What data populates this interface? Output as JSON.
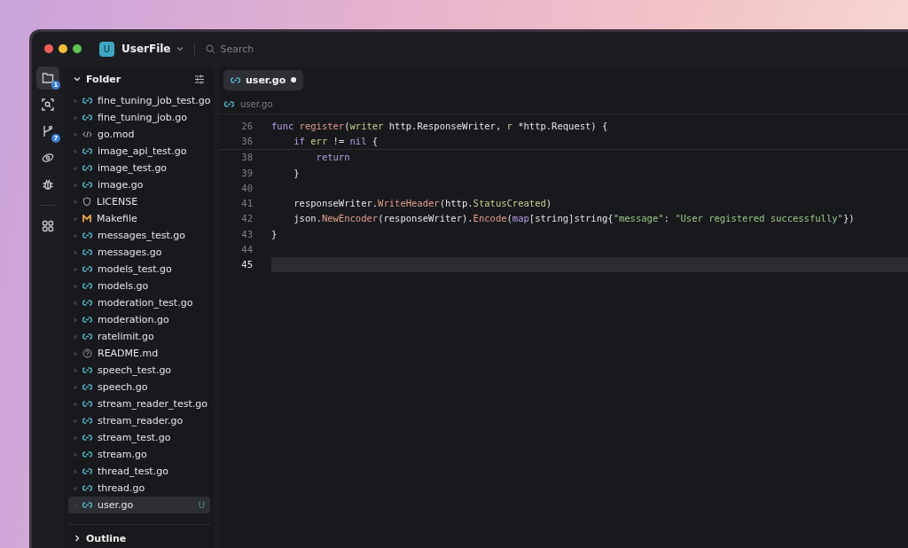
{
  "window": {
    "workspace_initial": "U",
    "workspace": "UserFile",
    "search_placeholder": "Search"
  },
  "activity_bar": [
    {
      "kind": "files",
      "badge": "1",
      "selected": true
    },
    {
      "kind": "scan",
      "selected": false
    },
    {
      "kind": "git",
      "badge": "7",
      "selected": false
    },
    {
      "kind": "eye",
      "selected": false
    },
    {
      "kind": "bug",
      "selected": false
    },
    {
      "kind": "separator"
    },
    {
      "kind": "grid",
      "selected": false
    }
  ],
  "sidebar": {
    "title": "Folder",
    "expanded": true,
    "outline": {
      "title": "Outline",
      "expanded": false
    },
    "items": [
      {
        "name": "fine_tuning_job_test.go",
        "kind": "go",
        "selected": false
      },
      {
        "name": "fine_tuning_job.go",
        "kind": "go",
        "selected": false
      },
      {
        "name": "go.mod",
        "kind": "mod",
        "selected": false
      },
      {
        "name": "image_api_test.go",
        "kind": "go",
        "selected": false
      },
      {
        "name": "image_test.go",
        "kind": "go",
        "selected": false
      },
      {
        "name": "image.go",
        "kind": "go",
        "selected": false
      },
      {
        "name": "LICENSE",
        "kind": "license",
        "selected": false
      },
      {
        "name": "Makefile",
        "kind": "make",
        "selected": false
      },
      {
        "name": "messages_test.go",
        "kind": "go",
        "selected": false
      },
      {
        "name": "messages.go",
        "kind": "go",
        "selected": false
      },
      {
        "name": "models_test.go",
        "kind": "go",
        "selected": false
      },
      {
        "name": "models.go",
        "kind": "go",
        "selected": false
      },
      {
        "name": "moderation_test.go",
        "kind": "go",
        "selected": false
      },
      {
        "name": "moderation.go",
        "kind": "go",
        "selected": false
      },
      {
        "name": "ratelimit.go",
        "kind": "go",
        "selected": false
      },
      {
        "name": "README.md",
        "kind": "readme",
        "selected": false
      },
      {
        "name": "speech_test.go",
        "kind": "go",
        "selected": false
      },
      {
        "name": "speech.go",
        "kind": "go",
        "selected": false
      },
      {
        "name": "stream_reader_test.go",
        "kind": "go",
        "selected": false
      },
      {
        "name": "stream_reader.go",
        "kind": "go",
        "selected": false
      },
      {
        "name": "stream_test.go",
        "kind": "go",
        "selected": false
      },
      {
        "name": "stream.go",
        "kind": "go",
        "selected": false
      },
      {
        "name": "thread_test.go",
        "kind": "go",
        "selected": false
      },
      {
        "name": "thread.go",
        "kind": "go",
        "selected": false
      },
      {
        "name": "user.go",
        "kind": "go",
        "selected": true,
        "status": "U"
      }
    ]
  },
  "tabs": [
    {
      "label": "user.go",
      "selected": true,
      "modified": true
    }
  ],
  "breadcrumb": "user.go",
  "sticky_lines": [
    {
      "number": "26",
      "current": false,
      "tokens": [
        {
          "text": "func ",
          "kind": "keyword"
        },
        {
          "text": "register",
          "kind": "function"
        },
        {
          "text": "(",
          "kind": "plain"
        },
        {
          "text": "writer",
          "kind": "variable"
        },
        {
          "text": " http.ResponseWriter, ",
          "kind": "plain"
        },
        {
          "text": "r",
          "kind": "variable"
        },
        {
          "text": " *http.Request) {",
          "kind": "plain"
        }
      ]
    },
    {
      "number": "36",
      "current": false,
      "tokens": [
        {
          "text": "    if ",
          "kind": "keyword"
        },
        {
          "text": "err",
          "kind": "variable"
        },
        {
          "text": " != ",
          "kind": "plain"
        },
        {
          "text": "nil",
          "kind": "keyword"
        },
        {
          "text": " {",
          "kind": "plain"
        }
      ]
    }
  ],
  "lines": [
    {
      "number": "38",
      "current": false,
      "tokens": [
        {
          "text": "        return",
          "kind": "keyword"
        }
      ]
    },
    {
      "number": "39",
      "current": false,
      "tokens": [
        {
          "text": "    }",
          "kind": "plain"
        }
      ]
    },
    {
      "number": "40",
      "current": false
    },
    {
      "number": "41",
      "current": false,
      "tokens": [
        {
          "text": "    responseWriter.",
          "kind": "plain"
        },
        {
          "text": "WriteHeader",
          "kind": "function"
        },
        {
          "text": "(http.",
          "kind": "plain"
        },
        {
          "text": "StatusCreated",
          "kind": "variable"
        },
        {
          "text": ")",
          "kind": "plain"
        }
      ]
    },
    {
      "number": "42",
      "current": false,
      "tokens": [
        {
          "text": "    json.",
          "kind": "plain"
        },
        {
          "text": "NewEncoder",
          "kind": "function"
        },
        {
          "text": "(responseWriter).",
          "kind": "plain"
        },
        {
          "text": "Encode",
          "kind": "function"
        },
        {
          "text": "(",
          "kind": "plain"
        },
        {
          "text": "map",
          "kind": "keyword"
        },
        {
          "text": "[string]string{",
          "kind": "plain"
        },
        {
          "text": "\"message\"",
          "kind": "string"
        },
        {
          "text": ": ",
          "kind": "plain"
        },
        {
          "text": "\"User registered successfully\"",
          "kind": "string"
        },
        {
          "text": "})",
          "kind": "plain"
        }
      ]
    },
    {
      "number": "43",
      "current": false,
      "tokens": [
        {
          "text": "}",
          "kind": "plain"
        }
      ]
    },
    {
      "number": "44",
      "current": false
    },
    {
      "number": "45",
      "current": true
    }
  ]
}
